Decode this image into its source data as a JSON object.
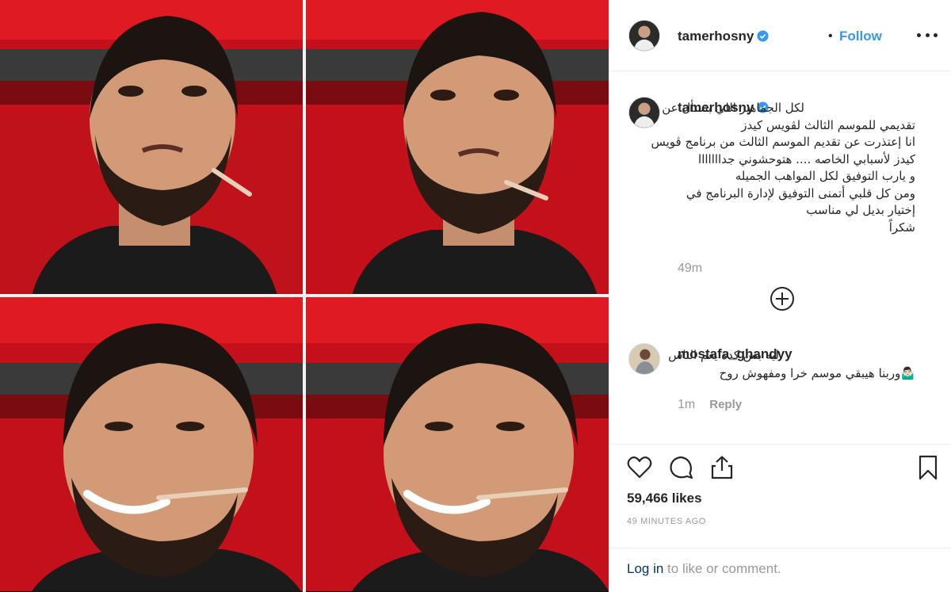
{
  "post": {
    "username": "tamerhosny",
    "follow_label": "Follow",
    "separator": "•",
    "caption_lines": [
      "لكل الجماهير اللي بتسأل عن",
      "تقديمي للموسم الثالث لڤويس كيدز",
      "انا إعتذرت عن تقديم الموسم الثالث من برنامج ڤويس",
      "كيدز لأسبابي الخاصه .... هتوحشوني جدااااااا",
      "و يارب التوفيق لكل المواهب الجميله",
      "ومن كل قلبي أتمنى التوفيق لإدارة البرنامج في",
      "إختيار بديل لي مناسب",
      "شكراً"
    ],
    "caption_time": "49m",
    "likes": "59,466 likes",
    "time_ago": "49 MINUTES AGO"
  },
  "comment": {
    "username": "mostafa_ghandyy",
    "text_lines": [
      "ليه بس كده يعم الناس",
      "🤷🏻‍♂️وربنا هيبقي موسم خرا ومفهوش روح"
    ],
    "time": "1m",
    "reply_label": "Reply"
  },
  "footer": {
    "login_label": "Log in",
    "login_suffix": " to like or comment."
  },
  "icons": {
    "verified": "verified-badge-icon",
    "more": "more-options-icon",
    "load_more": "plus-circle-icon",
    "like": "heart-icon",
    "comment": "comment-bubble-icon",
    "share": "share-icon",
    "save": "bookmark-icon"
  },
  "colors": {
    "accent": "#3897f0",
    "muted": "#999999",
    "text": "#262626",
    "link": "#003569",
    "background_red": "#d6121b"
  }
}
